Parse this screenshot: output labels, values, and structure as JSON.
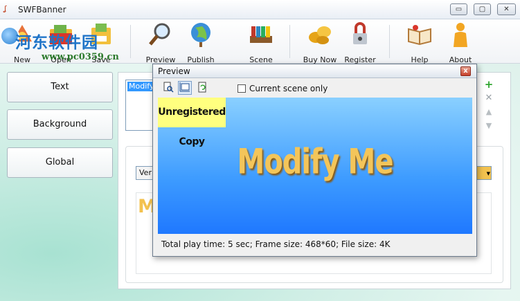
{
  "window": {
    "title": "SWFBanner",
    "min_glyph": "▭",
    "max_glyph": "▢",
    "close_glyph": "✕"
  },
  "watermark": {
    "text": "河东软件园",
    "url": "www.pc0359.cn"
  },
  "toolbar": {
    "items": [
      {
        "label": "New",
        "icon": "new-icon"
      },
      {
        "label": "Open",
        "icon": "open-folder-icon"
      },
      {
        "label": "Save",
        "icon": "save-icon"
      },
      {
        "label": "Preview",
        "icon": "magnifier-icon"
      },
      {
        "label": "Publish",
        "icon": "globe-icon"
      },
      {
        "label": "Scene",
        "icon": "books-icon"
      },
      {
        "label": "Buy Now",
        "icon": "coins-icon"
      },
      {
        "label": "Register",
        "icon": "lock-icon"
      },
      {
        "label": "Help",
        "icon": "open-book-icon"
      },
      {
        "label": "About",
        "icon": "person-icon"
      }
    ]
  },
  "sidebar": {
    "items": [
      {
        "label": "Text"
      },
      {
        "label": "Background"
      },
      {
        "label": "Global"
      }
    ]
  },
  "main": {
    "list_selected": "Modify",
    "font_select_value": "Ver",
    "sample_text": "M",
    "accent_color": "#f3c24f"
  },
  "edit_tools": {
    "add": "+",
    "delete": "✕",
    "up": "▲",
    "down": "▼"
  },
  "preview": {
    "title": "Preview",
    "close_glyph": "x",
    "tools": [
      "zoom-page-icon",
      "fit-frame-icon",
      "refresh-icon"
    ],
    "current_scene_label": "Current scene only",
    "current_scene_checked": false,
    "unregistered_label": "Unregistered Copy",
    "banner_text": "Modify Me",
    "status": "Total play time: 5 sec; Frame size: 468*60; File size: 4K"
  }
}
